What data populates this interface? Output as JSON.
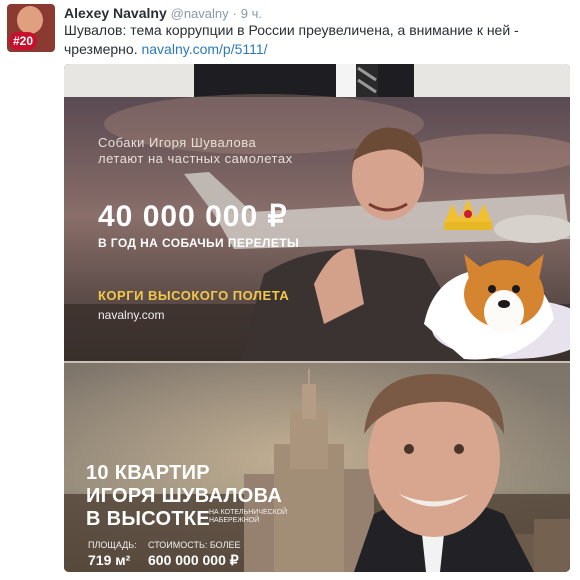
{
  "tweet": {
    "author": {
      "name": "Alexey Navalny",
      "handle": "@navalny",
      "badge": "#20"
    },
    "separator": "·",
    "time": "9 ч.",
    "text": "Шувалов: тема коррупции в России преувеличена, а внимание к ней - чрезмерно.",
    "link": "navalny.com/p/5111/"
  },
  "media": {
    "panel1": {
      "intro_line1": "Собаки Игоря Шувалова",
      "intro_line2": "летают на частных самолетах",
      "amount": "40 000 000 ₽",
      "amount_caption": "В ГОД НА СОБАЧЬИ ПЕРЕЛЕТЫ",
      "corgi_title": "КОРГИ ВЫСОКОГО ПОЛЕТА",
      "site": "navalny.com"
    },
    "panel2": {
      "title_line1": "10 КВАРТИР",
      "title_line2": "ИГОРЯ ШУВАЛОВА",
      "title_line3": "В ВЫСОТКЕ",
      "embankment": "НА КОТЕЛЬНИЧЕСКОЙ НАБЕРЕЖНОЙ",
      "area_label": "ПЛОЩАДЬ:",
      "area_value": "719 м²",
      "cost_label": "СТОИМОСТЬ: БОЛЕЕ",
      "cost_value": "600 000 000 ₽"
    }
  },
  "colors": {
    "link": "#2b7bb9",
    "accent_gold": "#f2c84b",
    "badge_red": "#c8102e"
  }
}
